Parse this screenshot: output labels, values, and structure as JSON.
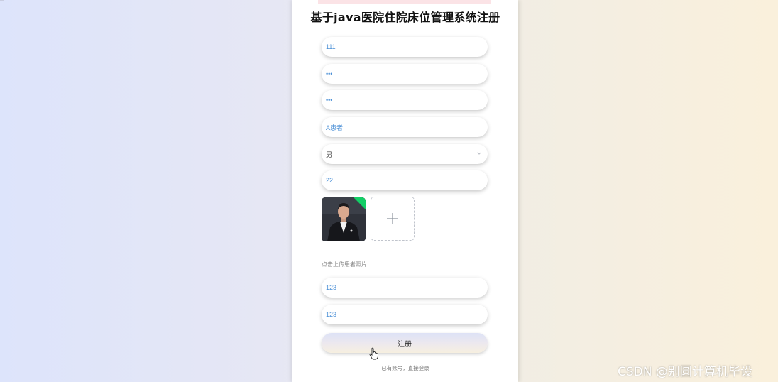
{
  "title": "基于java医院住院床位管理系统注册",
  "form": {
    "fields": [
      {
        "name": "username-field",
        "value": "111"
      },
      {
        "name": "password-field",
        "value": "•••"
      },
      {
        "name": "confirm-password-field",
        "value": "•••"
      },
      {
        "name": "name-field",
        "value": "A患者"
      }
    ],
    "gender": {
      "selected": "男"
    },
    "age": "22",
    "photo": {
      "hint": "点击上传患者照片"
    },
    "phone": "123",
    "id_number": "123"
  },
  "register_button": "注册",
  "login_link": "已有账号，直接登录",
  "watermark": "CSDN @别圆计算机毕设",
  "icons": {
    "select_arrow": "chevron-down-icon",
    "upload": "plus-icon",
    "cursor": "hand-pointer-icon"
  },
  "colors": {
    "value_text": "#4a8fd6",
    "success_badge": "#13ce66",
    "button_gradient": [
      "#dde2f6",
      "#f6efe0"
    ]
  }
}
